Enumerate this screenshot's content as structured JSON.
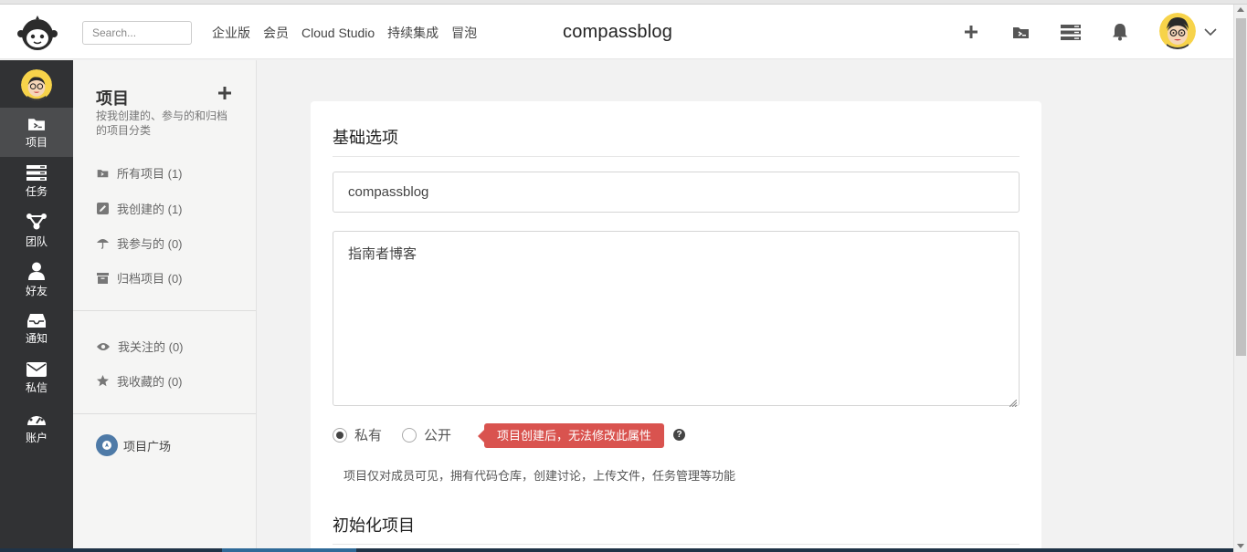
{
  "header": {
    "search_placeholder": "Search...",
    "nav": [
      "企业版",
      "会员",
      "Cloud Studio",
      "持续集成",
      "冒泡"
    ],
    "brand": "compassblog"
  },
  "leftbar": {
    "items": [
      {
        "label": "项目",
        "icon": "folder-terminal-icon",
        "active": true
      },
      {
        "label": "任务",
        "icon": "tasks-icon",
        "active": false
      },
      {
        "label": "团队",
        "icon": "team-icon",
        "active": false
      },
      {
        "label": "好友",
        "icon": "user-icon",
        "active": false
      },
      {
        "label": "通知",
        "icon": "inbox-icon",
        "active": false
      },
      {
        "label": "私信",
        "icon": "envelope-icon",
        "active": false
      },
      {
        "label": "账户",
        "icon": "dashboard-icon",
        "active": false
      }
    ]
  },
  "subbar": {
    "title": "项目",
    "desc": "按我创建的、参与的和归档的项目分类",
    "links": [
      {
        "label": "所有项目 (1)",
        "icon": "folder-terminal-icon"
      },
      {
        "label": "我创建的 (1)",
        "icon": "edit-icon"
      },
      {
        "label": "我参与的 (0)",
        "icon": "umbrella-icon"
      },
      {
        "label": "归档项目 (0)",
        "icon": "archive-icon"
      },
      {
        "label": "我关注的 (0)",
        "icon": "eye-icon"
      },
      {
        "label": "我收藏的 (0)",
        "icon": "star-icon"
      }
    ],
    "square": "项目广场"
  },
  "form": {
    "section1": "基础选项",
    "name_value": "compassblog",
    "desc_value": "指南者博客",
    "private_label": "私有",
    "public_label": "公开",
    "tooltip": "项目创建后，无法修改此属性",
    "help": "项目仅对成员可见，拥有代码仓库，创建讨论，上传文件，任务管理等功能",
    "section2": "初始化项目"
  },
  "colors": {
    "sidebar": "#313234",
    "sidebar_active": "#4b4c4e",
    "tooltip": "#d9534f",
    "square_icon": "#4e7aa7"
  }
}
